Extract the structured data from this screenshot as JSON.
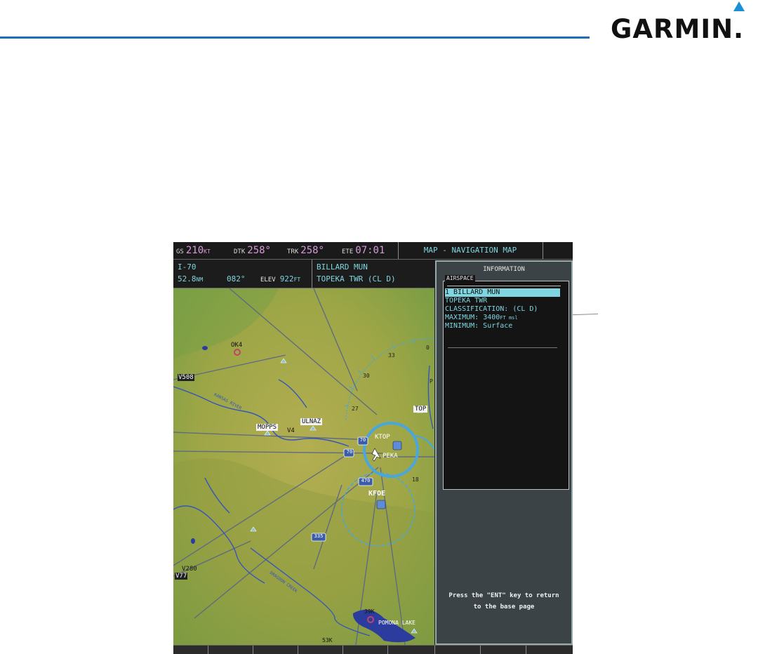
{
  "brand": {
    "name": "GARMIN."
  },
  "topbar": {
    "gs_label": "GS",
    "gs_value": "210",
    "gs_unit": "KT",
    "dtk_label": "DTK",
    "dtk_value": "258°",
    "trk_label": "TRK",
    "trk_value": "258°",
    "ete_label": "ETE",
    "ete_value": "07:01",
    "page_title": "MAP - NAVIGATION MAP"
  },
  "infobar": {
    "airway": "I-70",
    "distance": "52.8",
    "distance_unit": "NM",
    "bearing": "082°",
    "elev_label": "ELEV",
    "elev_value": "922",
    "elev_unit": "FT",
    "airport": "BILLARD MUN",
    "facility": "TOPEKA TWR (CL D)"
  },
  "panel": {
    "title": "INFORMATION",
    "group_label": "AIRSPACE",
    "rows": [
      "1 BILLARD MUN",
      "TOPEKA TWR",
      "CLASSIFICATION: (CL D)"
    ],
    "max_label": "MAXIMUM:",
    "max_value": "3400",
    "max_unit": "FT msl",
    "min_line": "MINIMUM: Surface",
    "help_line1": "Press the \"ENT\" key to return",
    "help_line2": "to the base page"
  },
  "map": {
    "labels": {
      "ok4": "OK4",
      "v508": "V508",
      "kansas_river": "KANSAS RIVER",
      "mopps": "MOPPS",
      "v4": "V4",
      "ulnaz": "ULNAZ",
      "ktop": "KTOP",
      "peka": "PEKA",
      "top": "TOP",
      "kfoe": "KFOE",
      "i70a": "70",
      "i70b": "70",
      "i470": "470",
      "i335": "335",
      "v280": "V280",
      "v77": "V77",
      "dragoon_creek": "DRAGOON CREEK",
      "k39": "39K",
      "pomona_lake": "POMONA LAKE",
      "k53": "53K",
      "r30": "30",
      "r27": "27",
      "r33": "33",
      "r0": "0",
      "r18": "18",
      "rp": "P"
    }
  },
  "colors": {
    "accent": "#1f6fb8",
    "cyan": "#7fd6e0",
    "magenta": "#d79ad9",
    "ring": "#47a7de"
  }
}
